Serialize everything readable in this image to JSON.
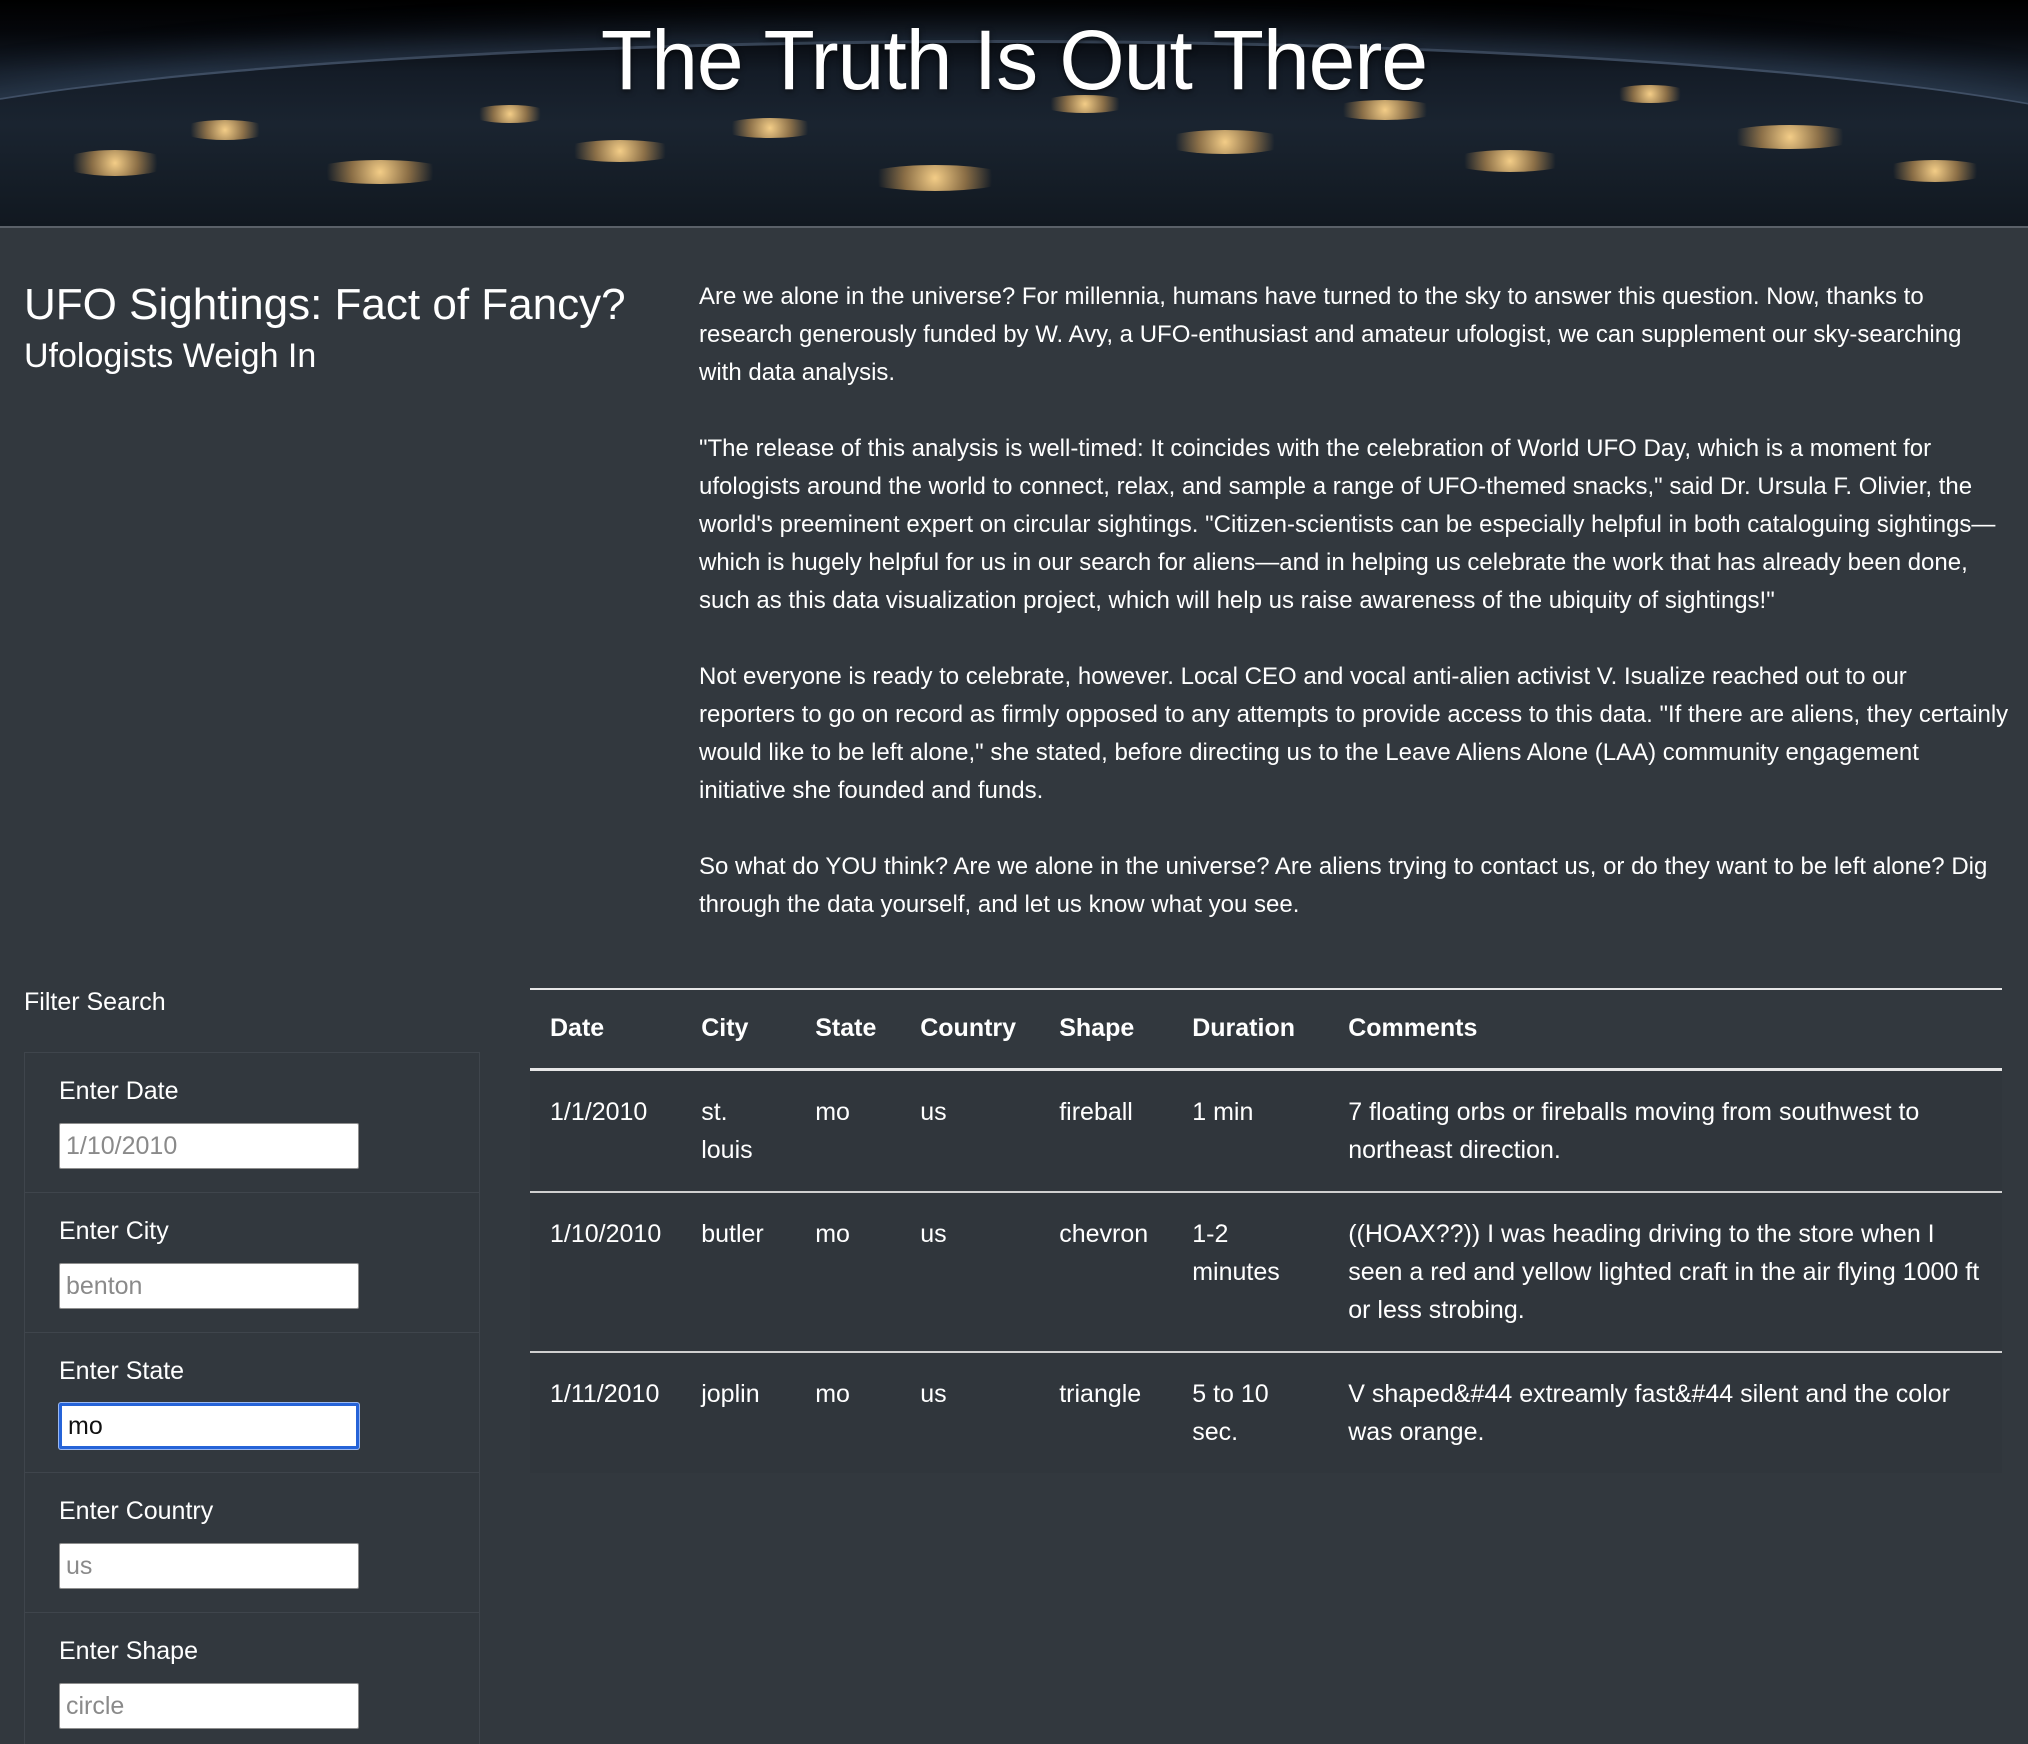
{
  "hero": {
    "title": "The Truth Is Out There"
  },
  "heading": {
    "title": "UFO Sightings: Fact of Fancy?",
    "subtitle": "Ufologists Weigh In"
  },
  "article": {
    "paragraphs": [
      "Are we alone in the universe? For millennia, humans have turned to the sky to answer this question. Now, thanks to research generously funded by W. Avy, a UFO-enthusiast and amateur ufologist, we can supplement our sky-searching with data analysis.",
      "\"The release of this analysis is well-timed: It coincides with the celebration of World UFO Day, which is a moment for ufologists around the world to connect, relax, and sample a range of UFO-themed snacks,\" said Dr. Ursula F. Olivier, the world's preeminent expert on circular sightings. \"Citizen-scientists can be especially helpful in both cataloguing sightings—which is hugely helpful for us in our search for aliens—and in helping us celebrate the work that has already been done, such as this data visualization project, which will help us raise awareness of the ubiquity of sightings!\"",
      "Not everyone is ready to celebrate, however. Local CEO and vocal anti-alien activist V. Isualize reached out to our reporters to go on record as firmly opposed to any attempts to provide access to this data. \"If there are aliens, they certainly would like to be left alone,\" she stated, before directing us to the Leave Aliens Alone (LAA) community engagement initiative she founded and funds.",
      "So what do YOU think? Are we alone in the universe? Are aliens trying to contact us, or do they want to be left alone? Dig through the data yourself, and let us know what you see."
    ]
  },
  "filters": {
    "title": "Filter Search",
    "date": {
      "label": "Enter Date",
      "placeholder": "1/10/2010",
      "value": ""
    },
    "city": {
      "label": "Enter City",
      "placeholder": "benton",
      "value": ""
    },
    "state": {
      "label": "Enter State",
      "placeholder": "",
      "value": "mo"
    },
    "country": {
      "label": "Enter Country",
      "placeholder": "us",
      "value": ""
    },
    "shape": {
      "label": "Enter Shape",
      "placeholder": "circle",
      "value": ""
    }
  },
  "table": {
    "headers": [
      "Date",
      "City",
      "State",
      "Country",
      "Shape",
      "Duration",
      "Comments"
    ],
    "rows": [
      [
        "1/1/2010",
        "st. louis",
        "mo",
        "us",
        "fireball",
        "1 min",
        "7 floating orbs or fireballs moving from southwest to northeast direction."
      ],
      [
        "1/10/2010",
        "butler",
        "mo",
        "us",
        "chevron",
        "1-2 minutes",
        "((HOAX??)) I was heading driving to the store when I seen a red and yellow lighted craft in the air flying 1000 ft or less strobing."
      ],
      [
        "1/11/2010",
        "joplin",
        "mo",
        "us",
        "triangle",
        "5 to 10 sec.",
        "V shaped&#44 extreamly fast&#44 silent and the color was orange."
      ]
    ]
  }
}
